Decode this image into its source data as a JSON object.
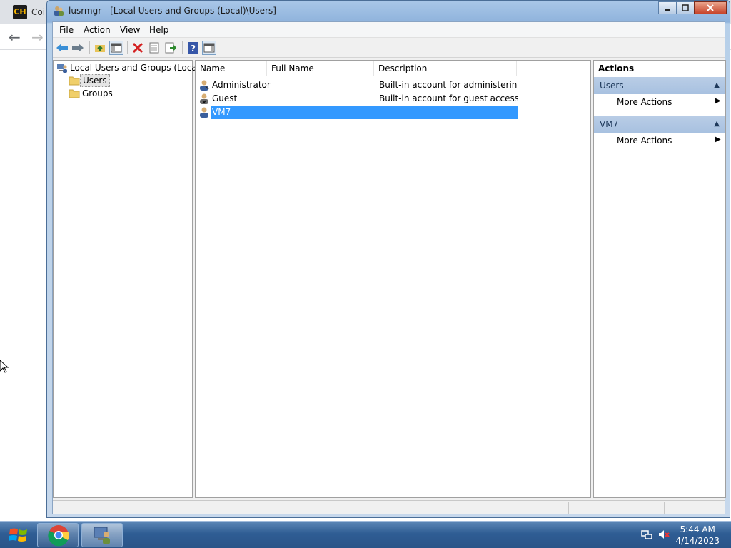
{
  "background_app": {
    "tab_title": "Coi",
    "tab_icon_text": "CH"
  },
  "window": {
    "title": "lusrmgr - [Local Users and Groups (Local)\\Users]"
  },
  "menu": [
    "File",
    "Action",
    "View",
    "Help"
  ],
  "tree": {
    "root": "Local Users and Groups (Local)",
    "children": [
      "Users",
      "Groups"
    ],
    "selected": "Users"
  },
  "list": {
    "columns": [
      "Name",
      "Full Name",
      "Description"
    ],
    "rows": [
      {
        "name": "Administrator",
        "full_name": "",
        "description": "Built-in account for administering..."
      },
      {
        "name": "Guest",
        "full_name": "",
        "description": "Built-in account for guest access t..."
      },
      {
        "name": "VM7",
        "full_name": "",
        "description": ""
      }
    ],
    "selected_row": "VM7"
  },
  "actions": {
    "header": "Actions",
    "sections": [
      {
        "title": "Users",
        "items": [
          "More Actions"
        ]
      },
      {
        "title": "VM7",
        "items": [
          "More Actions"
        ]
      }
    ]
  },
  "taskbar": {
    "time": "5:44 AM",
    "date": "4/14/2023"
  },
  "colors": {
    "selection": "#3399ff",
    "section_header": "#b9cde6"
  }
}
